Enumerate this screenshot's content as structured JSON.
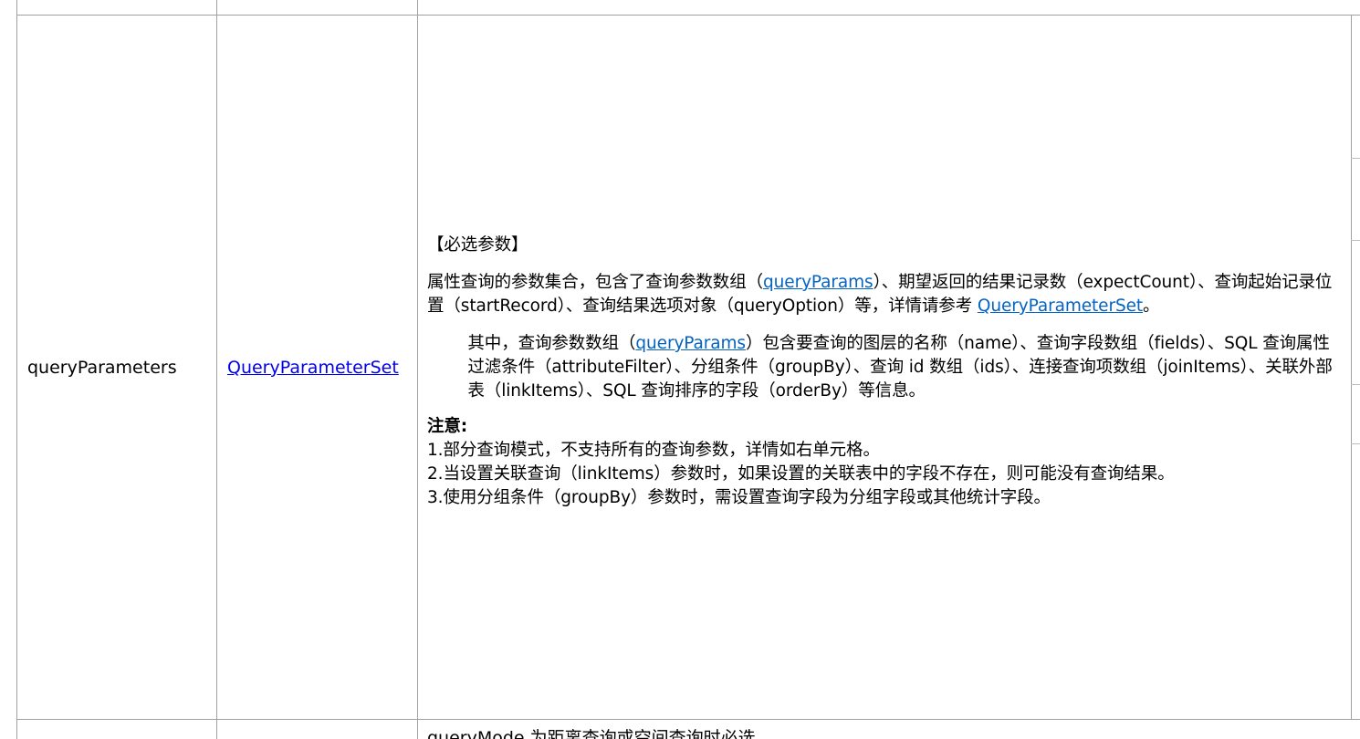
{
  "row": {
    "param_name": "queryParameters",
    "param_type_link": "QueryParameterSet",
    "required_tag": "【必选参数】",
    "para1": {
      "part1": "属性查询的参数集合，包含了查询参数数组（",
      "link1": "queryParams",
      "part2": "）、期望返回的结果记录数（expectCount）、查询起始记录位置（startRecord）、查询结果选项对象（queryOption）等，详情请参考 ",
      "link2": "QueryParameterSet",
      "part3": "。"
    },
    "para2": {
      "part1": "其中，查询参数数组（",
      "link1": "queryParams",
      "part2": "）包含要查询的图层的名称（name）、查询字段数组（fields）、SQL 查询属性过滤条件（attributeFilter）、分组条件（groupBy）、查询 id 数组（ids）、连接查询项数组（joinItems）、关联外部表（linkItems）、SQL 查询排序的字段（orderBy）等信息。"
    },
    "note_title": "注意:",
    "notes": [
      "1.部分查询模式，不支持所有的查询参数，详情如右单元格。",
      "2.当设置关联查询（linkItems）参数时，如果设置的关联表中的字段不存在，则可能没有查询结果。",
      "3.使用分组条件（groupBy）参数时，需设置查询字段为分组字段或其他统计字段。"
    ]
  },
  "next_row_partial": "queryMode 为距离查询或空间查询时必选"
}
